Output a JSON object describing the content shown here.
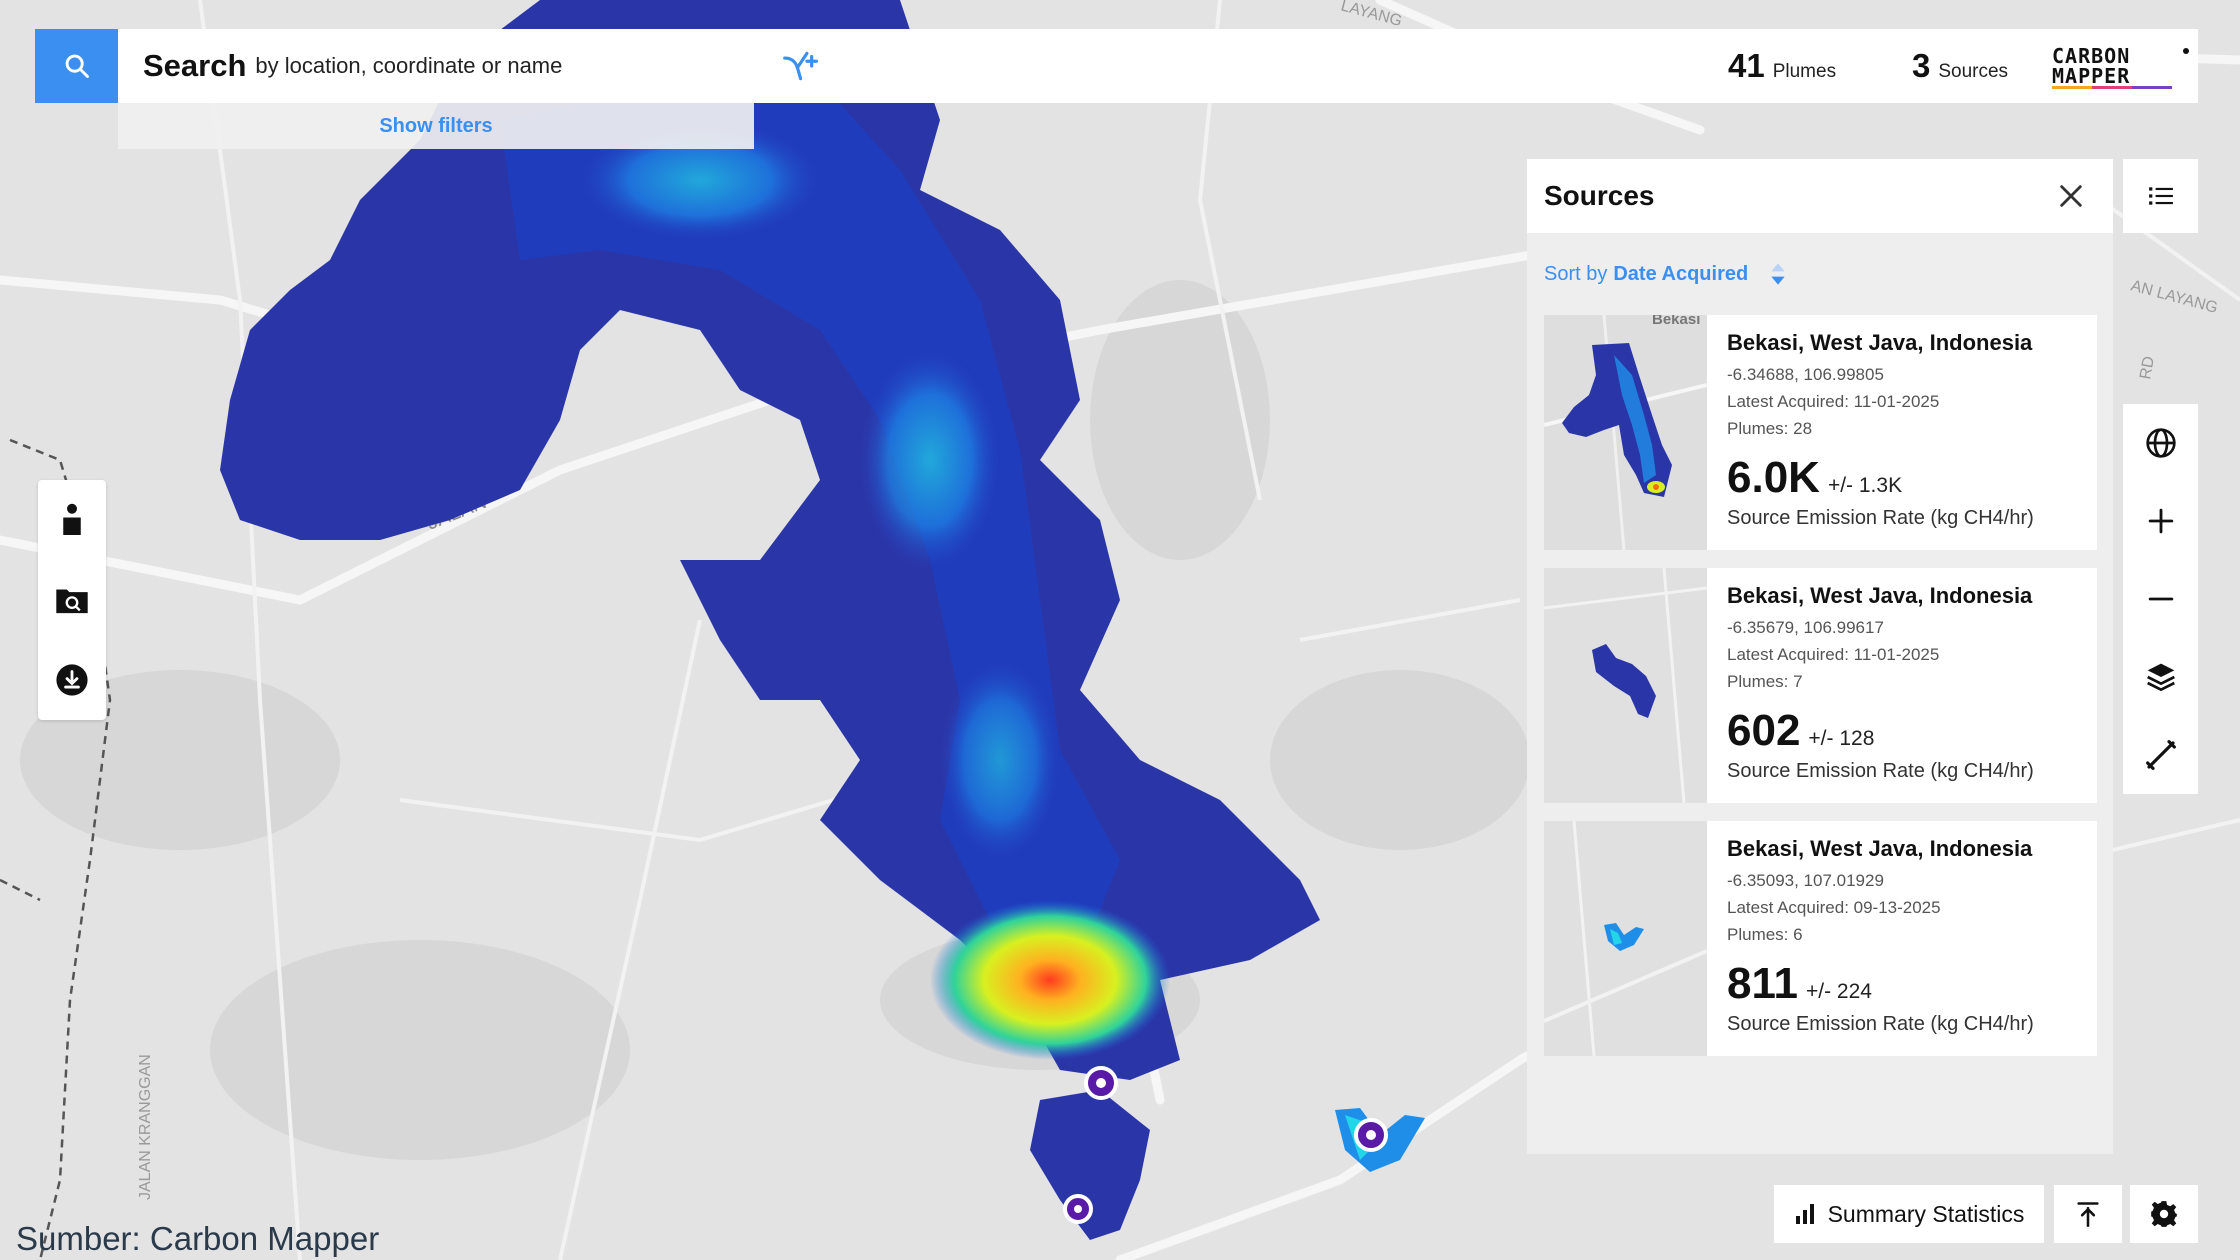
{
  "search": {
    "label": "Search",
    "placeholder": "by location, coordinate or name",
    "filters_link": "Show filters"
  },
  "stats": {
    "plumes_count": "41",
    "plumes_label": "Plumes",
    "sources_count": "3",
    "sources_label": "Sources"
  },
  "brand": {
    "line1": "CARBON",
    "line2": "MAPPER",
    "accent_colors": [
      "#f5a623",
      "#e0407a",
      "#7b3fc4"
    ]
  },
  "map": {
    "roads": [
      "JALAN",
      "JALAN KRANGGAN",
      "LAYANG",
      "AN LAYANG",
      "RD"
    ],
    "marker_color": "#5a1aa8"
  },
  "sources_panel": {
    "title": "Sources",
    "sort_label": "Sort by",
    "sort_value": "Date Acquired",
    "cards": [
      {
        "thumb_label": "Bekasi",
        "title": "Bekasi, West Java, Indonesia",
        "coords": "-6.34688, 106.99805",
        "acquired": "Latest Acquired: 11-01-2025",
        "plumes": "Plumes: 28",
        "rate": "6.0K",
        "uncertainty": "+/- 1.3K",
        "rate_label": "Source Emission Rate (kg CH4/hr)"
      },
      {
        "title": "Bekasi, West Java, Indonesia",
        "coords": "-6.35679, 106.99617",
        "acquired": "Latest Acquired: 11-01-2025",
        "plumes": "Plumes: 7",
        "rate": "602",
        "uncertainty": "+/- 128",
        "rate_label": "Source Emission Rate (kg CH4/hr)"
      },
      {
        "title": "Bekasi, West Java, Indonesia",
        "coords": "-6.35093, 107.01929",
        "acquired": "Latest Acquired: 09-13-2025",
        "plumes": "Plumes: 6",
        "rate": "811",
        "uncertainty": "+/- 224",
        "rate_label": "Source Emission Rate (kg CH4/hr)"
      }
    ]
  },
  "bottom_bar": {
    "summary_label": "Summary Statistics"
  },
  "caption": "Sumber: Carbon Mapper",
  "colors": {
    "accent": "#3a8ff0",
    "panel_bg": "#eeeeee"
  },
  "icons": [
    "search-icon",
    "path-mode-icon",
    "close-icon",
    "list-icon",
    "globe-icon",
    "zoom-in-icon",
    "zoom-out-icon",
    "layers-icon",
    "measure-icon",
    "person-icon",
    "folder-search-icon",
    "download-icon",
    "bar-chart-icon",
    "pin-icon",
    "gear-icon",
    "sort-icon"
  ]
}
